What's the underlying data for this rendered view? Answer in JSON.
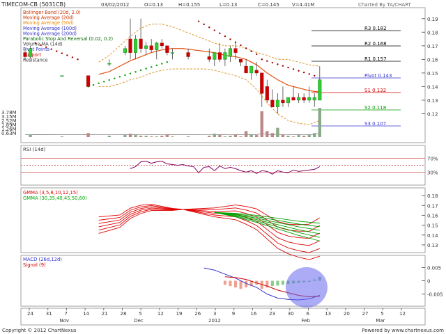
{
  "header": {
    "ticker": "TIMECOM-CB (5031CB)",
    "date": "03/02/2012",
    "open": "O=0.13",
    "high": "H=0.155",
    "low": "L=0.13",
    "close": "C=0.145",
    "volume": "V=4.41M",
    "charted_by": "Charted By TA/CHART"
  },
  "footer": {
    "copyright": "Copyright © 2012 ChartNexus",
    "powered": "Powered by www.chartnexus.com"
  },
  "colors": {
    "up": "#33cc33",
    "down": "#cc0000",
    "volume": "#a0a0a0",
    "volume_up": "#88aa88",
    "volume_down": "#bb8888",
    "bollinger": "#e0a040",
    "ma20": "#e05010",
    "psar_up": "#00a000",
    "psar_down": "#a00000",
    "pivot": "#6666cc",
    "support": "#cc3333",
    "rsi": "#800060",
    "macd": "#3333cc",
    "signal": "#cc0000",
    "highlight": "#6666ee"
  },
  "chart_data": [
    {
      "panel": "price",
      "type": "candlestick",
      "legend": [
        {
          "label": "Bollinger Band (20d, 2.0)",
          "color": "#cc3300"
        },
        {
          "label": "Moving Average (20d)",
          "color": "#cc3300"
        },
        {
          "label": "Moving Average (50d)",
          "color": "#ee8800"
        },
        {
          "label": "Moving Average (100d)",
          "color": "#3333cc"
        },
        {
          "label": "Moving Average (200d)",
          "color": "#3333cc"
        },
        {
          "label": "Parabolic Stop And Reversal (0.02, 0.2)",
          "color": "#006600"
        },
        {
          "label": "Volume MA (14d)",
          "color": "#333333"
        },
        {
          "label": "Pivot Points",
          "color": "#3333cc"
        },
        {
          "label": "Support",
          "color": "#cc0000"
        },
        {
          "label": "Resistance",
          "color": "#333333"
        }
      ],
      "y_ticks": [
        0.12,
        0.13,
        0.14,
        0.15,
        0.16,
        0.17,
        0.18,
        0.19
      ],
      "ylim": [
        0.11,
        0.195
      ],
      "volume_ticks": [
        "3.78M",
        "3.15M",
        "2.52M",
        "1.89M",
        "1.26M",
        "0.63M"
      ],
      "volume_max": 4.41,
      "pivot_levels": [
        {
          "label": "R3 0.182",
          "value": 0.182
        },
        {
          "label": "R2 0.168",
          "value": 0.168
        },
        {
          "label": "R1 0.157",
          "value": 0.157
        },
        {
          "label": "Pivot 0.143",
          "value": 0.143
        },
        {
          "label": "S1 0.132",
          "value": 0.132
        },
        {
          "label": "S2 0.118",
          "value": 0.118
        },
        {
          "label": "S3 0.107",
          "value": 0.107
        }
      ],
      "candles": [
        {
          "i": 0,
          "o": 0.165,
          "h": 0.168,
          "l": 0.16,
          "c": 0.162,
          "v": 0
        },
        {
          "i": 1,
          "o": 0.162,
          "h": 0.17,
          "l": 0.16,
          "c": 0.168,
          "v": 0.4
        },
        {
          "i": 7,
          "o": 0.148,
          "h": 0.148,
          "l": 0.148,
          "c": 0.148,
          "v": 0.1
        },
        {
          "i": 12,
          "o": 0.148,
          "h": 0.148,
          "l": 0.14,
          "c": 0.14,
          "v": 0.6
        },
        {
          "i": 16,
          "o": 0.157,
          "h": 0.16,
          "l": 0.155,
          "c": 0.157,
          "v": 0.2
        },
        {
          "i": 19,
          "o": 0.165,
          "h": 0.17,
          "l": 0.163,
          "c": 0.168,
          "v": 0.3
        },
        {
          "i": 20,
          "o": 0.175,
          "h": 0.19,
          "l": 0.16,
          "c": 0.165,
          "v": 0.5
        },
        {
          "i": 21,
          "o": 0.165,
          "h": 0.178,
          "l": 0.16,
          "c": 0.175,
          "v": 0.3
        },
        {
          "i": 22,
          "o": 0.175,
          "h": 0.19,
          "l": 0.165,
          "c": 0.168,
          "v": 0.2
        },
        {
          "i": 23,
          "o": 0.168,
          "h": 0.173,
          "l": 0.163,
          "c": 0.17,
          "v": 0.2
        },
        {
          "i": 24,
          "o": 0.17,
          "h": 0.175,
          "l": 0.165,
          "c": 0.167,
          "v": 0.1
        },
        {
          "i": 25,
          "o": 0.167,
          "h": 0.173,
          "l": 0.16,
          "c": 0.172,
          "v": 0.1
        },
        {
          "i": 26,
          "o": 0.172,
          "h": 0.175,
          "l": 0.168,
          "c": 0.17,
          "v": 0.2
        },
        {
          "i": 27,
          "o": 0.17,
          "h": 0.17,
          "l": 0.163,
          "c": 0.165,
          "v": 0.4
        },
        {
          "i": 28,
          "o": 0.165,
          "h": 0.168,
          "l": 0.16,
          "c": 0.165,
          "v": 0.1
        },
        {
          "i": 31,
          "o": 0.165,
          "h": 0.168,
          "l": 0.16,
          "c": 0.162,
          "v": 0.1
        },
        {
          "i": 35,
          "o": 0.162,
          "h": 0.168,
          "l": 0.158,
          "c": 0.16,
          "v": 0.2
        },
        {
          "i": 36,
          "o": 0.16,
          "h": 0.165,
          "l": 0.155,
          "c": 0.165,
          "v": 0.5
        },
        {
          "i": 37,
          "o": 0.165,
          "h": 0.172,
          "l": 0.158,
          "c": 0.16,
          "v": 0.3
        },
        {
          "i": 38,
          "o": 0.16,
          "h": 0.168,
          "l": 0.155,
          "c": 0.165,
          "v": 0.1
        },
        {
          "i": 39,
          "o": 0.162,
          "h": 0.17,
          "l": 0.158,
          "c": 0.168,
          "v": 0.2
        },
        {
          "i": 40,
          "o": 0.168,
          "h": 0.173,
          "l": 0.16,
          "c": 0.165,
          "v": 0.4
        },
        {
          "i": 41,
          "o": 0.16,
          "h": 0.16,
          "l": 0.155,
          "c": 0.158,
          "v": 0.1
        },
        {
          "i": 42,
          "o": 0.155,
          "h": 0.16,
          "l": 0.15,
          "c": 0.15,
          "v": 0.9
        },
        {
          "i": 43,
          "o": 0.15,
          "h": 0.155,
          "l": 0.145,
          "c": 0.155,
          "v": 0.4
        },
        {
          "i": 44,
          "o": 0.152,
          "h": 0.158,
          "l": 0.148,
          "c": 0.15,
          "v": 0.3
        },
        {
          "i": 45,
          "o": 0.15,
          "h": 0.15,
          "l": 0.125,
          "c": 0.135,
          "v": 3.9
        },
        {
          "i": 46,
          "o": 0.14,
          "h": 0.145,
          "l": 0.128,
          "c": 0.13,
          "v": 0.9
        },
        {
          "i": 47,
          "o": 0.13,
          "h": 0.138,
          "l": 0.125,
          "c": 0.125,
          "v": 0.6
        },
        {
          "i": 48,
          "o": 0.125,
          "h": 0.135,
          "l": 0.12,
          "c": 0.13,
          "v": 1.4
        },
        {
          "i": 49,
          "o": 0.13,
          "h": 0.14,
          "l": 0.125,
          "c": 0.128,
          "v": 0.4
        },
        {
          "i": 50,
          "o": 0.128,
          "h": 0.132,
          "l": 0.125,
          "c": 0.132,
          "v": 0.2
        },
        {
          "i": 51,
          "o": 0.132,
          "h": 0.14,
          "l": 0.13,
          "c": 0.13,
          "v": 0.1
        },
        {
          "i": 52,
          "o": 0.13,
          "h": 0.135,
          "l": 0.128,
          "c": 0.132,
          "v": 0.3
        },
        {
          "i": 53,
          "o": 0.132,
          "h": 0.135,
          "l": 0.128,
          "c": 0.13,
          "v": 0.2
        },
        {
          "i": 54,
          "o": 0.13,
          "h": 0.14,
          "l": 0.128,
          "c": 0.132,
          "v": 0.3
        },
        {
          "i": 55,
          "o": 0.13,
          "h": 0.135,
          "l": 0.125,
          "c": 0.132,
          "v": 0.6
        },
        {
          "i": 56,
          "o": 0.13,
          "h": 0.155,
          "l": 0.13,
          "c": 0.145,
          "v": 4.41
        }
      ]
    },
    {
      "panel": "rsi",
      "type": "line",
      "title": "RSI (14d)",
      "levels": [
        {
          "label": "70%",
          "value": 70
        },
        {
          "label": "30%",
          "value": 30
        }
      ],
      "ylim": [
        0,
        100
      ],
      "values": [
        [
          20,
          40
        ],
        [
          21,
          46
        ],
        [
          22,
          60
        ],
        [
          23,
          62
        ],
        [
          24,
          56
        ],
        [
          25,
          60
        ],
        [
          26,
          62
        ],
        [
          27,
          54
        ],
        [
          28,
          52
        ],
        [
          29,
          50
        ],
        [
          30,
          52
        ],
        [
          31,
          48
        ],
        [
          32,
          46
        ],
        [
          33,
          28
        ],
        [
          34,
          44
        ],
        [
          35,
          46
        ],
        [
          36,
          34
        ],
        [
          37,
          48
        ],
        [
          38,
          40
        ],
        [
          39,
          44
        ],
        [
          40,
          40
        ],
        [
          41,
          34
        ],
        [
          42,
          30
        ],
        [
          43,
          34
        ],
        [
          44,
          26
        ],
        [
          45,
          34
        ],
        [
          46,
          32
        ],
        [
          47,
          24
        ],
        [
          48,
          34
        ],
        [
          49,
          30
        ],
        [
          50,
          28
        ],
        [
          51,
          36
        ],
        [
          52,
          32
        ],
        [
          53,
          34
        ],
        [
          54,
          36
        ],
        [
          55,
          38
        ],
        [
          56,
          46
        ]
      ]
    },
    {
      "panel": "gmma",
      "type": "line",
      "legend": [
        {
          "label": "GMMA (3,5,8,10,12,15)",
          "color": "#dd0000"
        },
        {
          "label": "GMMA (30,35,40,45,50,60)",
          "color": "#00aa00"
        }
      ],
      "y_ticks": [
        0.13,
        0.14,
        0.15,
        0.16,
        0.17,
        0.18
      ],
      "ylim": [
        0.125,
        0.185
      ]
    },
    {
      "panel": "macd",
      "type": "line",
      "legend": [
        {
          "label": "MACD (26d,12d)",
          "color": "#3333cc"
        },
        {
          "label": "Signal (9)",
          "color": "#cc0000"
        }
      ],
      "y_ticks": [
        0.005,
        0,
        -0.005
      ],
      "y_tick_labels": [
        "0.005",
        "0",
        "-0.005"
      ],
      "ylim": [
        -0.0085,
        0.0085
      ]
    }
  ],
  "x_axis": {
    "days": [
      "24",
      "31",
      "7",
      "14",
      "21",
      "28",
      "5",
      "12",
      "19",
      "26",
      "3",
      "9",
      "16",
      "23",
      "30",
      "6",
      "13",
      "20",
      "27",
      "5",
      "12"
    ],
    "months": [
      "Nov",
      "Dec",
      "2012",
      "Feb",
      "Mar"
    ],
    "month_positions": [
      2,
      6,
      10,
      15,
      19
    ]
  }
}
